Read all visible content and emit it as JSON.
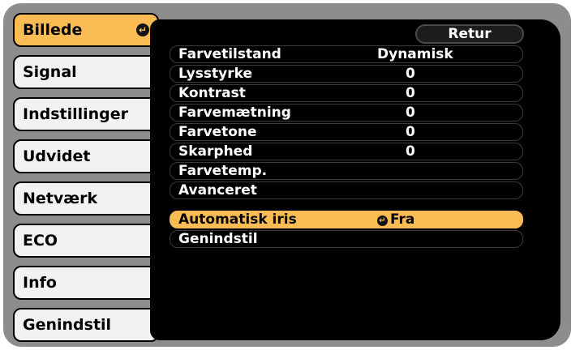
{
  "sidebar": {
    "items": [
      {
        "label": "Billede",
        "active": true
      },
      {
        "label": "Signal"
      },
      {
        "label": "Indstillinger"
      },
      {
        "label": "Udvidet"
      },
      {
        "label": "Netværk"
      },
      {
        "label": "ECO"
      },
      {
        "label": "Info"
      },
      {
        "label": "Genindstil"
      }
    ]
  },
  "panel": {
    "return_label": "Retur",
    "rows": [
      {
        "label": "Farvetilstand",
        "value": "Dynamisk"
      },
      {
        "label": "Lysstyrke",
        "value": "0"
      },
      {
        "label": "Kontrast",
        "value": "0"
      },
      {
        "label": "Farvemætning",
        "value": "0"
      },
      {
        "label": "Farvetone",
        "value": "0"
      },
      {
        "label": "Skarphed",
        "value": "0"
      },
      {
        "label": "Farvetemp.",
        "value": ""
      },
      {
        "label": "Avanceret",
        "value": ""
      },
      {
        "label": "Automatisk iris",
        "value": "Fra",
        "selected": true
      },
      {
        "label": "Genindstil",
        "value": ""
      }
    ]
  },
  "colors": {
    "accent": "#f9bb54",
    "frame": "#8d8d8d",
    "panel": "#000000",
    "tab": "#f2f2f2"
  },
  "icons": {
    "enter": "enter-icon"
  }
}
